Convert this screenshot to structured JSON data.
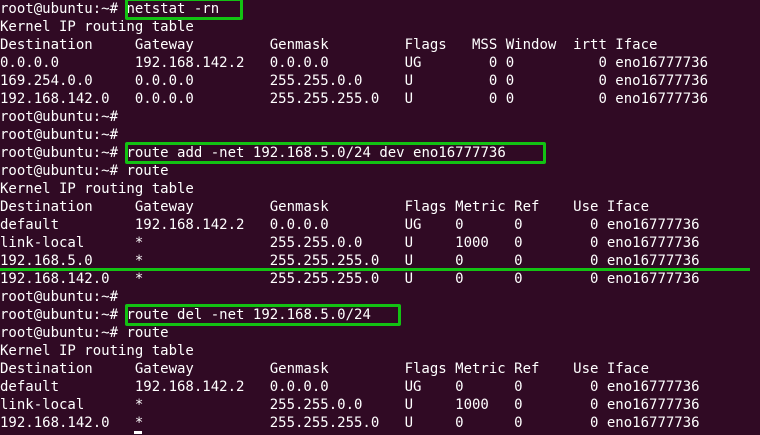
{
  "terminal": {
    "lines": [
      {
        "prompt": "root@ubuntu:~#",
        "command": "netstat -rn"
      },
      {
        "text": "Kernel IP routing table"
      },
      {
        "text": "Destination     Gateway         Genmask         Flags   MSS Window  irtt Iface"
      },
      {
        "text": "0.0.0.0         192.168.142.2   0.0.0.0         UG        0 0          0 eno16777736"
      },
      {
        "text": "169.254.0.0     0.0.0.0         255.255.0.0     U         0 0          0 eno16777736"
      },
      {
        "text": "192.168.142.0   0.0.0.0         255.255.255.0   U         0 0          0 eno16777736"
      },
      {
        "prompt": "root@ubuntu:~#",
        "command": ""
      },
      {
        "prompt": "root@ubuntu:~#",
        "command": ""
      },
      {
        "prompt": "root@ubuntu:~#",
        "command": "route add -net 192.168.5.0/24 dev eno16777736"
      },
      {
        "prompt": "root@ubuntu:~#",
        "command": "route"
      },
      {
        "text": "Kernel IP routing table"
      },
      {
        "text": "Destination     Gateway         Genmask         Flags Metric Ref    Use Iface"
      },
      {
        "text": "default         192.168.142.2   0.0.0.0         UG    0      0        0 eno16777736"
      },
      {
        "text": "link-local      *               255.255.0.0     U     1000   0        0 eno16777736"
      },
      {
        "text": "192.168.5.0     *               255.255.255.0   U     0      0        0 eno16777736"
      },
      {
        "text": "192.168.142.0   *               255.255.255.0   U     0      0        0 eno16777736"
      },
      {
        "prompt": "root@ubuntu:~#",
        "command": ""
      },
      {
        "prompt": "root@ubuntu:~#",
        "command": "route del -net 192.168.5.0/24"
      },
      {
        "prompt": "root@ubuntu:~#",
        "command": "route"
      },
      {
        "text": "Kernel IP routing table"
      },
      {
        "text": "Destination     Gateway         Genmask         Flags Metric Ref    Use Iface"
      },
      {
        "text": "default         192.168.142.2   0.0.0.0         UG    0      0        0 eno16777736"
      },
      {
        "text": "link-local      *               255.255.0.0     U     1000   0        0 eno16777736"
      },
      {
        "text": "192.168.142.0   *               255.255.255.0   U     0      0        0 eno16777736"
      }
    ]
  },
  "colors": {
    "background": "#300a24",
    "text": "#ffffff",
    "highlight": "#13c213"
  }
}
